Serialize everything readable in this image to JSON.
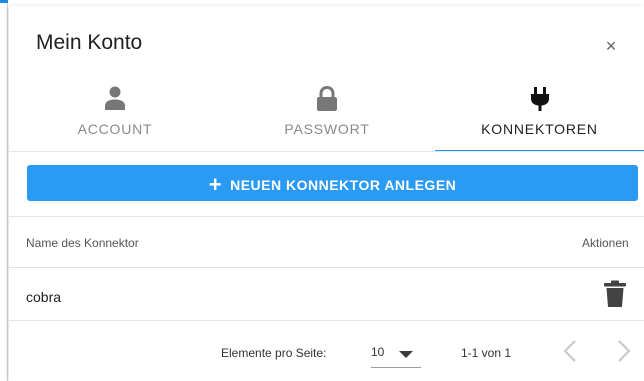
{
  "dialog": {
    "title": "Mein Konto",
    "close_glyph": "×"
  },
  "tabs": [
    {
      "label": "ACCOUNT",
      "icon": "person-icon",
      "active": false
    },
    {
      "label": "PASSWORT",
      "icon": "lock-icon",
      "active": false
    },
    {
      "label": "KONNEKTOREN",
      "icon": "plug-icon",
      "active": true
    }
  ],
  "add_button": {
    "label": "NEUEN KONNEKTOR ANLEGEN",
    "icon": "plus-icon"
  },
  "table": {
    "headers": {
      "name": "Name des Konnektor",
      "actions": "Aktionen"
    },
    "rows": [
      {
        "name": "cobra",
        "action_icon": "trash-icon"
      }
    ]
  },
  "pagination": {
    "items_per_page_label": "Elemente pro Seite:",
    "page_size": "10",
    "range_label": "1-1 von 1"
  },
  "colors": {
    "accent": "#2196f3",
    "button": "#2b9af3",
    "inactive_icon": "#777777",
    "active_icon": "#111111"
  }
}
